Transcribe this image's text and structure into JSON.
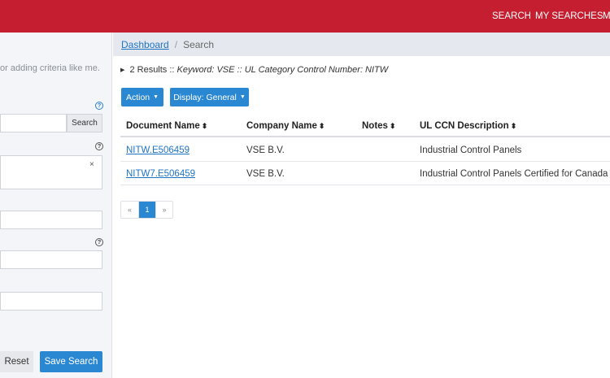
{
  "topnav": {
    "search": "SEARCH",
    "my_searches": "MY SEARCHES",
    "more_partial": "M"
  },
  "sidebar": {
    "hint": "or adding criteria like me.",
    "search_button": "Search",
    "clear_symbol": "×",
    "help_symbol": "?",
    "reset_button": "Reset",
    "save_search_button": "Save Search"
  },
  "breadcrumb": {
    "dashboard": "Dashboard",
    "separator": "/",
    "current": "Search"
  },
  "results": {
    "count_text": "2 Results ::",
    "criteria_text": "Keyword: VSE :: UL Category Control Number: NITW"
  },
  "toolbar": {
    "action_label": "Action",
    "display_label": "Display: General"
  },
  "table": {
    "sort_symbol": "⬍",
    "headers": [
      "Document Name",
      "Company Name",
      "Notes",
      "UL CCN Description"
    ],
    "rows": [
      {
        "document": "NITW.E506459",
        "company": "VSE B.V.",
        "notes": "",
        "description": "Industrial Control Panels"
      },
      {
        "document": "NITW7.E506459",
        "company": "VSE B.V.",
        "notes": "",
        "description": "Industrial Control Panels Certified for Canada"
      }
    ]
  },
  "pagination": {
    "prev": "«",
    "current_page": "1",
    "next": "»"
  },
  "colors": {
    "brand_red": "#c41e30",
    "primary_blue": "#2a87d2",
    "link_blue": "#1f74c4"
  }
}
